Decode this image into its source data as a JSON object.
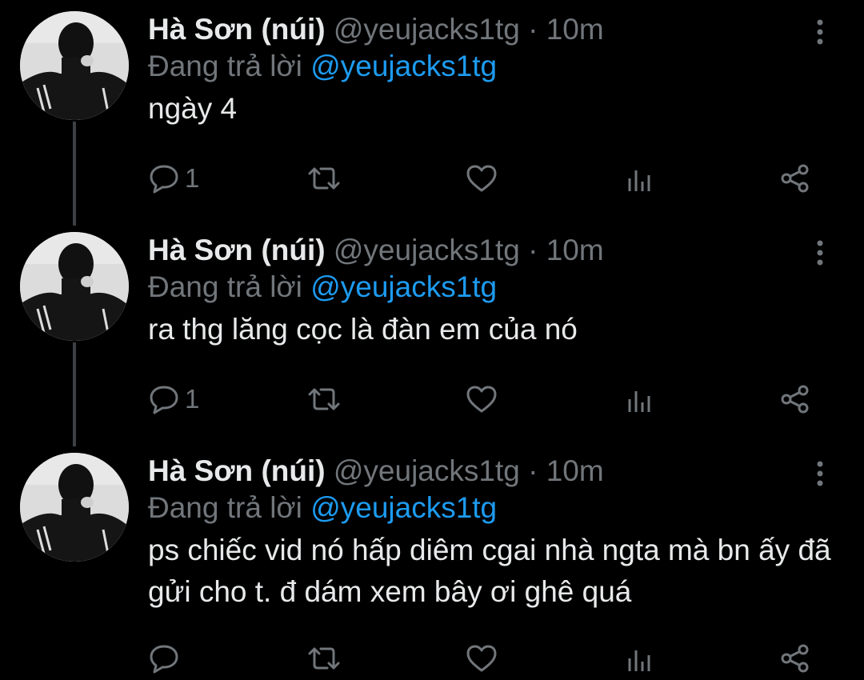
{
  "tweets": [
    {
      "author": {
        "name": "Hà Sơn (núi)",
        "handle": "@yeujacks1tg"
      },
      "separator": "·",
      "time": "10m",
      "reply_prefix": "Đang trả lời",
      "reply_to": "@yeujacks1tg",
      "text": "ngày 4",
      "reply_count": "1"
    },
    {
      "author": {
        "name": "Hà Sơn (núi)",
        "handle": "@yeujacks1tg"
      },
      "separator": "·",
      "time": "10m",
      "reply_prefix": "Đang trả lời",
      "reply_to": "@yeujacks1tg",
      "text": "ra thg lăng cọc là đàn em của nó",
      "reply_count": "1"
    },
    {
      "author": {
        "name": "Hà Sơn (núi)",
        "handle": "@yeujacks1tg"
      },
      "separator": "·",
      "time": "10m",
      "reply_prefix": "Đang trả lời",
      "reply_to": "@yeujacks1tg",
      "text": "ps chiếc vid nó hấp diêm cgai nhà ngta mà bn ấy đã gửi cho t. đ dám xem bây ơi ghê quá",
      "reply_count": ""
    }
  ],
  "icons": {
    "reply": "speech-bubble-icon",
    "retweet": "retweet-arrows-icon",
    "like": "heart-icon",
    "analytics": "bar-chart-icon",
    "share": "share-nodes-icon",
    "more": "vertical-ellipsis-icon"
  },
  "colors": {
    "background": "#000000",
    "text": "#e7e9ea",
    "muted": "#71767b",
    "accent": "#1d9bf0",
    "thread_line": "#3d4045"
  }
}
